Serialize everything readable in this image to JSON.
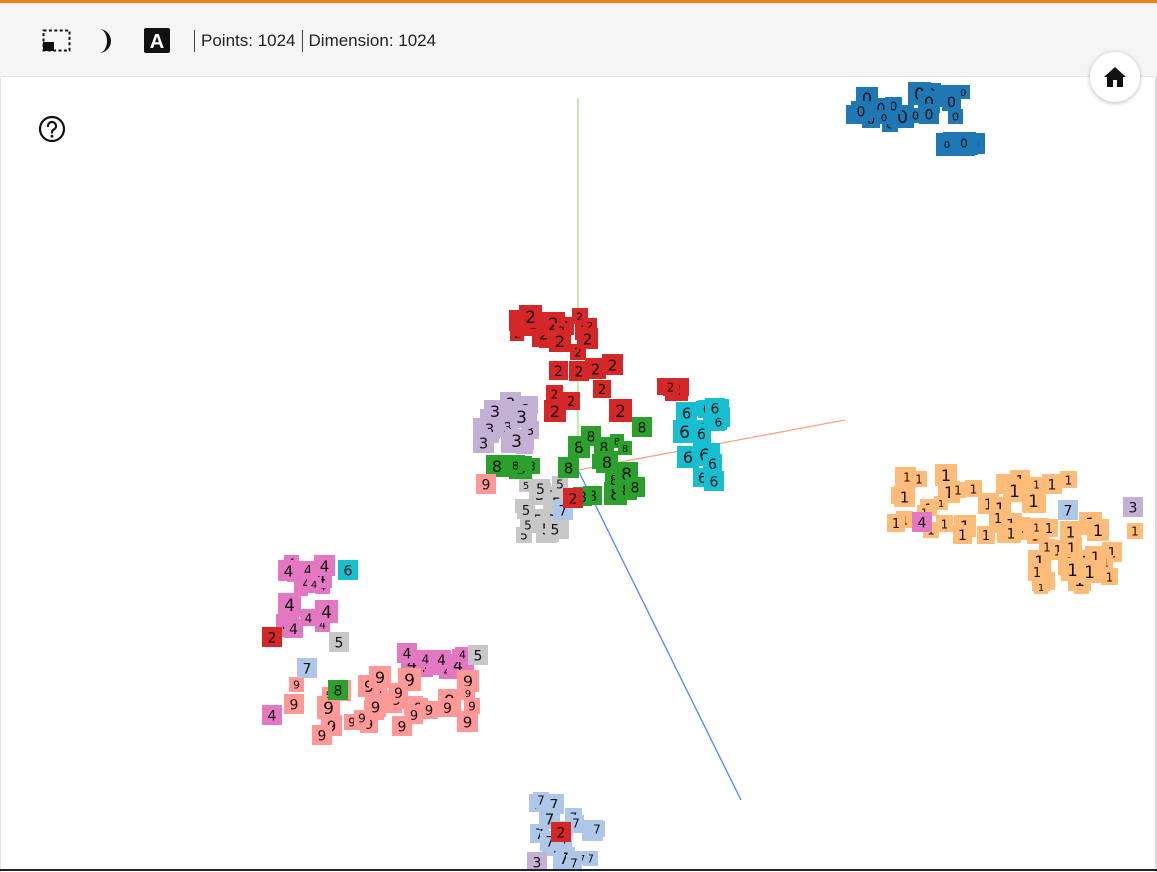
{
  "toolbar": {
    "selection_icon": "selection-rect-icon",
    "night_mode_icon": "night-mode-icon",
    "label_icon": "label-toggle-icon",
    "label_glyph": "A",
    "points_text": "Points: 1024",
    "dimension_text": "Dimension: 1024"
  },
  "buttons": {
    "home_icon": "home-icon",
    "help_icon": "help-icon"
  },
  "colors": {
    "accent": "#ef7d1a",
    "digit_0": "#1f77b4",
    "digit_1": "#ffbb78",
    "digit_2": "#d62728",
    "digit_3": "#c5b0d5",
    "digit_4": "#e377c2",
    "digit_5": "#c7c7c7",
    "digit_6": "#17becf",
    "digit_7": "#aec7e8",
    "digit_8": "#2ca02c",
    "digit_9": "#ff9896",
    "axis_x": "#f4a582",
    "axis_y": "#9de07a",
    "axis_z": "#4f86f7"
  },
  "clusters": [
    {
      "digit": "0",
      "color": "#1f77b4",
      "count": 46
    },
    {
      "digit": "1",
      "color": "#ffbb78",
      "count": 70
    },
    {
      "digit": "2",
      "color": "#d62728",
      "count": 48
    },
    {
      "digit": "3",
      "color": "#c5b0d5",
      "count": 22
    },
    {
      "digit": "4",
      "color": "#e377c2",
      "count": 34
    },
    {
      "digit": "5",
      "color": "#c7c7c7",
      "count": 18
    },
    {
      "digit": "6",
      "color": "#17becf",
      "count": 20
    },
    {
      "digit": "7",
      "color": "#aec7e8",
      "count": 20
    },
    {
      "digit": "8",
      "color": "#2ca02c",
      "count": 28
    },
    {
      "digit": "9",
      "color": "#ff9896",
      "count": 32
    }
  ]
}
